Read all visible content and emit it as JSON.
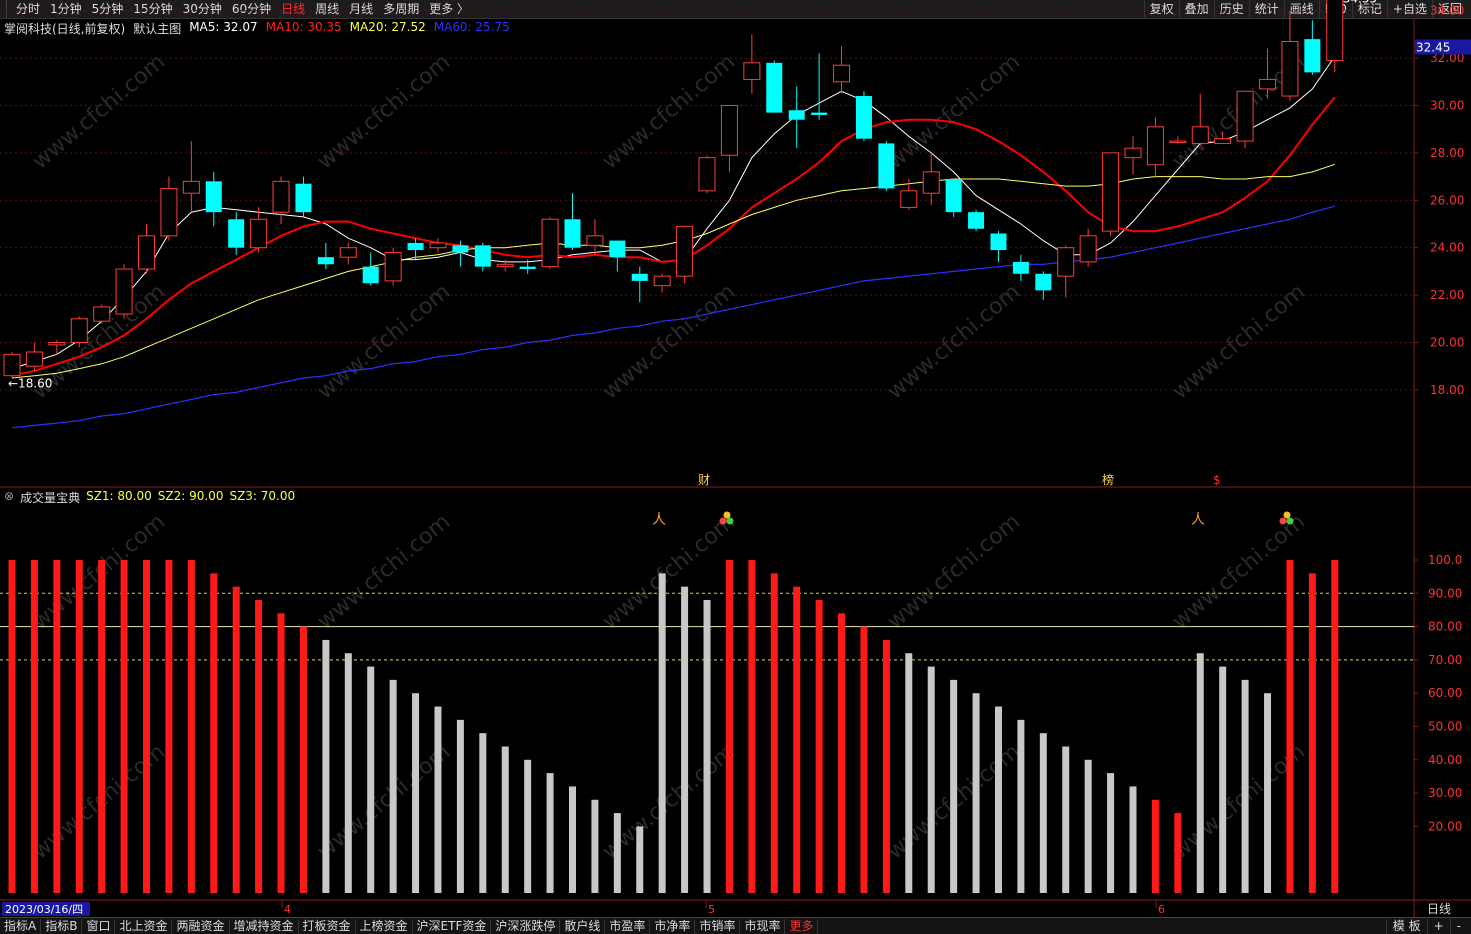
{
  "toolbar": {
    "periods": [
      "分时",
      "1分钟",
      "5分钟",
      "15分钟",
      "30分钟",
      "60分钟",
      "日线",
      "周线",
      "月线",
      "多周期",
      "更多 〉"
    ],
    "active_period": "日线",
    "right": [
      "复权",
      "叠加",
      "历史",
      "统计",
      "画线",
      "F10",
      "标记",
      "+自选",
      "返回"
    ]
  },
  "main_info": {
    "stock": "掌阅科技(日线,前复权)",
    "template": "默认主图",
    "ma5": "MA5: 32.07",
    "ma10": "MA10: 30.35",
    "ma20": "MA20: 27.52",
    "ma60": "MA60: 25.75"
  },
  "indicator_info": {
    "name": "成交量宝典",
    "sz1": "SZ1: 80.00",
    "sz2": "SZ2: 90.00",
    "sz3": "SZ3: 70.00"
  },
  "price_axis": [
    "34.00",
    "32.00",
    "30.00",
    "28.00",
    "26.00",
    "24.00",
    "22.00",
    "20.00",
    "18.00"
  ],
  "current_price": "32.45",
  "high_label": "34.55",
  "low_label": "18.60",
  "indicator_axis": [
    "100.0",
    "90.00",
    "80.00",
    "70.00",
    "60.00",
    "50.00",
    "40.00",
    "30.00",
    "20.00"
  ],
  "event_marks": [
    "财",
    "榜",
    "$"
  ],
  "date_label": "2023/03/16/四",
  "month_labels": [
    "4",
    "5",
    "6"
  ],
  "bottom_right_label": "日线",
  "bottom_tabs": [
    "指标A",
    "指标B",
    "窗口",
    "北上资金",
    "两融资金",
    "增减持资金",
    "打板资金",
    "上榜资金",
    "沪深ETF资金",
    "沪深涨跌停",
    "散户线",
    "市盈率",
    "市净率",
    "市销率",
    "市现率",
    "更多"
  ],
  "bottom_right": [
    "模 板",
    "+",
    "-"
  ],
  "watermark": "www.cfchi.com",
  "colors": {
    "up": "#ff3b3b",
    "down": "#00ffff",
    "ma5": "#ffffff",
    "ma10": "#ff0000",
    "ma20": "#ffff66",
    "ma60": "#3030ff",
    "bar_red": "#ff1a1a",
    "bar_gray": "#c8c8c8"
  },
  "chart_data": [
    {
      "type": "candlestick",
      "ylim": [
        16,
        35
      ],
      "candles": [
        [
          18.6,
          19.5,
          18.5,
          19.6
        ],
        [
          19.0,
          19.6,
          18.8,
          20.0
        ],
        [
          19.9,
          20.0,
          19.5,
          20.1
        ],
        [
          20.0,
          21.0,
          19.8,
          21.1
        ],
        [
          20.9,
          21.5,
          20.8,
          21.6
        ],
        [
          21.2,
          23.1,
          21.0,
          23.3
        ],
        [
          23.1,
          24.5,
          22.9,
          25.0
        ],
        [
          24.5,
          26.5,
          24.3,
          27.0
        ],
        [
          26.3,
          26.8,
          25.5,
          28.5
        ],
        [
          26.8,
          25.5,
          24.9,
          27.2
        ],
        [
          25.2,
          24.0,
          23.7,
          25.5
        ],
        [
          24.0,
          25.2,
          23.8,
          25.7
        ],
        [
          25.5,
          26.8,
          25.0,
          27.0
        ],
        [
          26.7,
          25.5,
          25.3,
          27.0
        ],
        [
          23.6,
          23.3,
          23.1,
          24.2
        ],
        [
          23.6,
          24.0,
          23.3,
          24.2
        ],
        [
          23.2,
          22.5,
          22.4,
          23.8
        ],
        [
          22.6,
          23.8,
          22.4,
          24.0
        ],
        [
          24.2,
          23.9,
          23.5,
          24.4
        ],
        [
          24.0,
          24.2,
          23.8,
          24.4
        ],
        [
          24.1,
          23.8,
          23.2,
          24.3
        ],
        [
          24.1,
          23.2,
          23.0,
          24.2
        ],
        [
          23.2,
          23.3,
          23.0,
          23.5
        ],
        [
          23.2,
          23.1,
          22.9,
          23.5
        ],
        [
          23.2,
          25.2,
          23.1,
          25.3
        ],
        [
          25.2,
          24.0,
          23.9,
          26.3
        ],
        [
          24.1,
          24.5,
          23.7,
          25.2
        ],
        [
          24.3,
          23.6,
          23.0,
          24.3
        ],
        [
          22.9,
          22.6,
          21.7,
          23.2
        ],
        [
          22.4,
          22.8,
          22.1,
          22.9
        ],
        [
          22.8,
          24.9,
          22.5,
          24.9
        ],
        [
          26.4,
          27.8,
          26.3,
          27.9
        ],
        [
          27.9,
          30.0,
          27.2,
          30.0
        ],
        [
          31.1,
          31.8,
          30.5,
          33.0
        ],
        [
          31.8,
          29.7,
          29.7,
          31.9
        ],
        [
          29.8,
          29.4,
          28.2,
          30.8
        ],
        [
          29.7,
          29.6,
          29.4,
          32.2
        ],
        [
          31.0,
          31.7,
          30.5,
          32.5
        ],
        [
          30.4,
          28.6,
          28.5,
          30.6
        ],
        [
          28.4,
          26.5,
          26.4,
          28.5
        ],
        [
          25.7,
          26.4,
          25.6,
          26.9
        ],
        [
          26.3,
          27.2,
          25.8,
          28.0
        ],
        [
          26.9,
          25.5,
          25.3,
          26.9
        ],
        [
          25.5,
          24.8,
          24.7,
          25.6
        ],
        [
          24.6,
          23.9,
          23.4,
          24.7
        ],
        [
          23.4,
          22.9,
          22.6,
          23.7
        ],
        [
          22.9,
          22.2,
          21.8,
          23.0
        ],
        [
          22.8,
          24.0,
          21.9,
          24.1
        ],
        [
          23.4,
          24.5,
          23.2,
          24.8
        ],
        [
          24.7,
          28.0,
          24.5,
          28.0
        ],
        [
          27.8,
          28.2,
          27.1,
          28.7
        ],
        [
          27.5,
          29.1,
          27.0,
          29.5
        ],
        [
          28.5,
          28.5,
          28.4,
          28.7
        ],
        [
          28.4,
          29.1,
          28.3,
          30.5
        ],
        [
          28.4,
          28.6,
          28.4,
          28.9
        ],
        [
          28.5,
          30.6,
          28.2,
          30.6
        ],
        [
          30.7,
          31.1,
          30.3,
          32.4
        ],
        [
          30.4,
          32.7,
          30.2,
          34.0
        ],
        [
          32.8,
          31.4,
          31.3,
          33.6
        ],
        [
          31.9,
          34.5,
          31.4,
          34.55
        ]
      ],
      "ma_series": [
        {
          "name": "MA5",
          "values": [
            18.9,
            19.2,
            19.5,
            20.1,
            20.9,
            21.9,
            23.0,
            24.6,
            25.5,
            25.7,
            25.6,
            25.5,
            25.4,
            25.3,
            25.0,
            24.4,
            24.0,
            23.5,
            23.5,
            23.6,
            23.8,
            23.5,
            23.4,
            23.4,
            23.5,
            23.7,
            23.8,
            23.9,
            23.9,
            23.4,
            23.5,
            24.8,
            26.0,
            27.8,
            28.8,
            29.6,
            30.1,
            30.6,
            30.2,
            29.5,
            28.7,
            28.0,
            27.2,
            26.2,
            25.6,
            25.0,
            24.3,
            23.7,
            23.7,
            24.2,
            25.1,
            26.2,
            27.3,
            28.4,
            28.5,
            28.9,
            29.4,
            29.9,
            30.7,
            32.07
          ]
        },
        {
          "name": "MA10",
          "values": [
            18.6,
            18.8,
            19.1,
            19.4,
            19.8,
            20.3,
            21.0,
            21.8,
            22.5,
            23.0,
            23.5,
            24.0,
            24.5,
            24.9,
            25.1,
            25.1,
            24.8,
            24.6,
            24.4,
            24.2,
            24.1,
            23.9,
            23.7,
            23.6,
            23.7,
            23.6,
            23.7,
            23.6,
            23.6,
            23.4,
            23.5,
            24.1,
            24.8,
            25.7,
            26.3,
            26.9,
            27.6,
            28.5,
            29.0,
            29.3,
            29.4,
            29.4,
            29.3,
            29.0,
            28.5,
            27.9,
            27.2,
            26.4,
            25.5,
            24.9,
            24.7,
            24.7,
            24.9,
            25.2,
            25.5,
            26.1,
            26.8,
            27.9,
            29.2,
            30.35
          ]
        },
        {
          "name": "MA20",
          "values": [
            18.5,
            18.6,
            18.7,
            18.9,
            19.1,
            19.4,
            19.8,
            20.2,
            20.6,
            21.0,
            21.4,
            21.8,
            22.1,
            22.4,
            22.7,
            23.0,
            23.2,
            23.4,
            23.6,
            23.7,
            23.9,
            24.0,
            24.0,
            24.1,
            24.2,
            24.1,
            24.1,
            24.0,
            24.0,
            24.1,
            24.3,
            24.6,
            25.0,
            25.4,
            25.7,
            26.0,
            26.2,
            26.4,
            26.5,
            26.6,
            26.7,
            26.8,
            26.9,
            26.9,
            26.9,
            26.8,
            26.7,
            26.6,
            26.6,
            26.7,
            26.9,
            27.0,
            27.0,
            27.0,
            26.9,
            26.9,
            27.0,
            27.0,
            27.2,
            27.52
          ]
        },
        {
          "name": "MA60",
          "values": [
            16.4,
            16.5,
            16.6,
            16.7,
            16.9,
            17.0,
            17.2,
            17.4,
            17.6,
            17.8,
            17.9,
            18.1,
            18.3,
            18.5,
            18.6,
            18.8,
            18.9,
            19.1,
            19.2,
            19.4,
            19.5,
            19.7,
            19.8,
            20.0,
            20.1,
            20.3,
            20.4,
            20.6,
            20.7,
            20.9,
            21.0,
            21.2,
            21.4,
            21.6,
            21.8,
            22.0,
            22.2,
            22.4,
            22.6,
            22.7,
            22.8,
            22.9,
            23.0,
            23.1,
            23.2,
            23.3,
            23.3,
            23.4,
            23.5,
            23.6,
            23.8,
            24.0,
            24.2,
            24.4,
            24.6,
            24.8,
            25.0,
            25.2,
            25.5,
            25.75
          ]
        }
      ]
    },
    {
      "type": "bar",
      "name": "成交量宝典",
      "ylim": [
        0,
        100
      ],
      "values": [
        100,
        100,
        100,
        100,
        100,
        100,
        100,
        100,
        100,
        96,
        92,
        88,
        84,
        80,
        76,
        72,
        68,
        64,
        60,
        56,
        52,
        48,
        44,
        40,
        36,
        32,
        28,
        24,
        20,
        96,
        92,
        88,
        100,
        100,
        96,
        92,
        88,
        84,
        80,
        76,
        72,
        68,
        64,
        60,
        56,
        52,
        48,
        44,
        40,
        36,
        32,
        28,
        24,
        72,
        68,
        64,
        60,
        100,
        96,
        100
      ],
      "colors": [
        "r",
        "r",
        "r",
        "r",
        "r",
        "r",
        "r",
        "r",
        "r",
        "r",
        "r",
        "r",
        "r",
        "r",
        "g",
        "g",
        "g",
        "g",
        "g",
        "g",
        "g",
        "g",
        "g",
        "g",
        "g",
        "g",
        "g",
        "g",
        "g",
        "g",
        "g",
        "g",
        "r",
        "r",
        "r",
        "r",
        "r",
        "r",
        "r",
        "r",
        "g",
        "g",
        "g",
        "g",
        "g",
        "g",
        "g",
        "g",
        "g",
        "g",
        "g",
        "r",
        "r",
        "g",
        "g",
        "g",
        "g",
        "r",
        "r",
        "r"
      ],
      "reference_lines": [
        80,
        90,
        70
      ]
    }
  ]
}
